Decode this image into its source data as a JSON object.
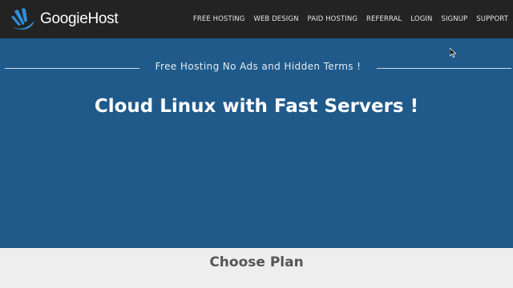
{
  "brand": {
    "name": "GoogieHost",
    "accent_color": "#2f8fd8"
  },
  "nav": {
    "items": [
      {
        "label": "FREE HOSTING"
      },
      {
        "label": "WEB DESIGN"
      },
      {
        "label": "PAID HOSTING"
      },
      {
        "label": "REFERRAL"
      },
      {
        "label": "LOGIN"
      },
      {
        "label": "SIGNUP"
      },
      {
        "label": "SUPPORT"
      }
    ]
  },
  "hero": {
    "tagline": "Free Hosting No Ads and Hidden Terms !",
    "title": "Cloud Linux with Fast Servers !",
    "background_color": "#205a8a"
  },
  "plans": {
    "title": "Choose Plan"
  },
  "icons": {
    "logo": "googiehost-logo-icon",
    "cursor": "mouse-pointer-icon"
  }
}
